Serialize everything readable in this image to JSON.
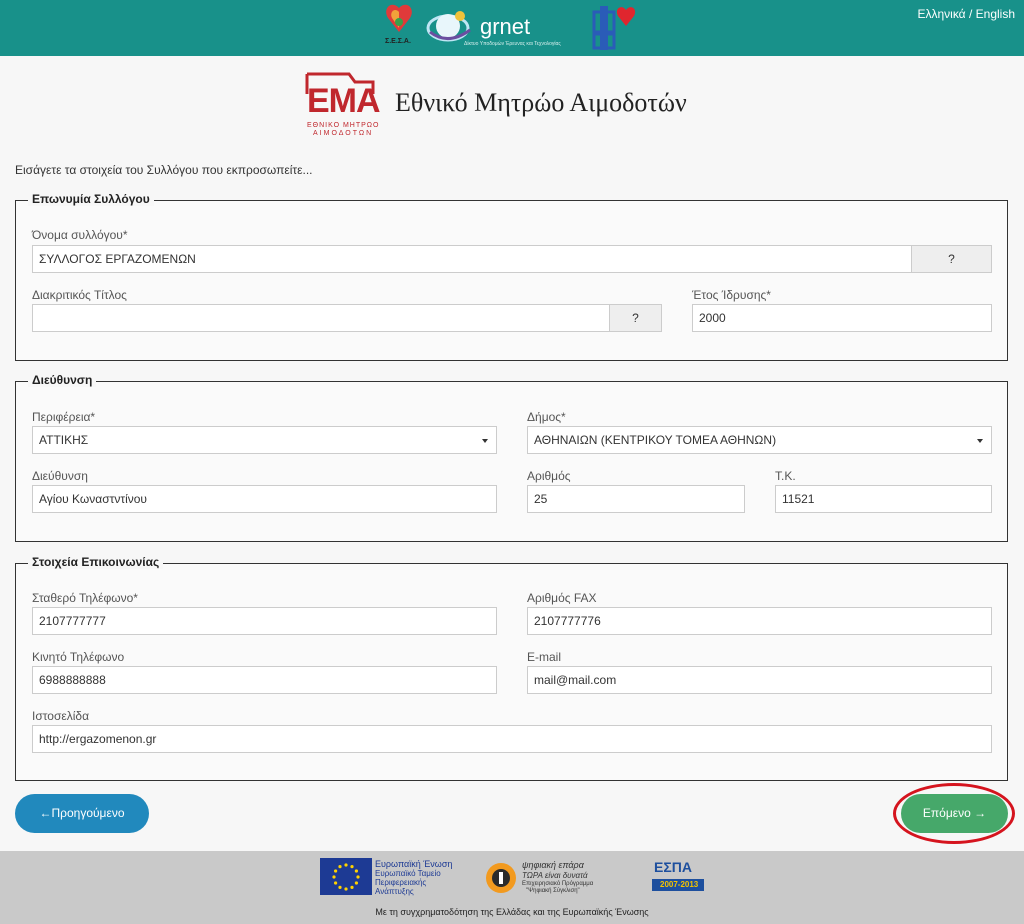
{
  "header": {
    "lang_greek": "Ελληνικά",
    "lang_sep": " / ",
    "lang_english": "English",
    "grnet_word": "grnet",
    "grnet_tagline": "Δίκτυο Υποδομών Έρευνας και Τεχνολογίας",
    "eseth_label": "Σ.Ε.Σ.Α."
  },
  "brand": {
    "title": "Εθνικό Μητρώο Αιμοδοτών",
    "logo_text": "ΕΜΑ",
    "logo_sub1": "ΕΘΝΙΚΟ ΜΗΤΡΩΟ",
    "logo_sub2": "ΑΙΜΟΔΟΤΩΝ"
  },
  "intro": "Εισάγετε τα στοιχεία του Συλλόγου που εκπροσωπείτε...",
  "section_name": {
    "legend": "Επωνυμία Συλλόγου",
    "name_label": "Όνομα συλλόγου*",
    "name_value": "ΣΥΛΛΟΓΟΣ ΕΡΓΑΖΟΜΕΝΩΝ",
    "help1": "?",
    "title_label": "Διακριτικός Τίτλος",
    "title_value": "",
    "help2": "?",
    "year_label": "Έτος Ίδρυσης*",
    "year_value": "2000"
  },
  "section_address": {
    "legend": "Διεύθυνση",
    "region_label": "Περιφέρεια*",
    "region_value": "ΑΤΤΙΚΗΣ",
    "municipality_label": "Δήμος*",
    "municipality_value": "ΑΘΗΝΑΙΩΝ (ΚΕΝΤΡΙΚΟΥ ΤΟΜΕΑ ΑΘΗΝΩΝ)",
    "street_label": "Διεύθυνση",
    "street_value": "Αγίου Κωναστντίνου",
    "number_label": "Αριθμός",
    "number_value": "25",
    "postcode_label": "Τ.Κ.",
    "postcode_value": "11521"
  },
  "section_contact": {
    "legend": "Στοιχεία Επικοινωνίας",
    "phone_label": "Σταθερό Τηλέφωνο*",
    "phone_value": "2107777777",
    "fax_label": "Αριθμός FAX",
    "fax_value": "2107777776",
    "mobile_label": "Κινητό Τηλέφωνο",
    "mobile_value": "6988888888",
    "email_label": "E-mail",
    "email_value": "mail@mail.com",
    "website_label": "Ιστοσελίδα",
    "website_value": "http://ergazomenon.gr"
  },
  "nav": {
    "prev_label": "Προηγούμενο",
    "next_label": "Επόμενο"
  },
  "footer": {
    "eu_line1": "Ευρωπαϊκή Ένωση",
    "eu_line2": "Ευρωπαϊκό Ταμείο",
    "eu_line3": "Περιφερειακής",
    "eu_line4": "Ανάπτυξης",
    "digital_line1": "ψηφιακή επάρα",
    "digital_line2": "ΤΩΡΑ είναι δυνατά",
    "digital_line3": "Επιχειρησιακό Πρόγραμμα",
    "digital_line4": "\"Ψηφιακή Σύγκλιση\"",
    "espa_word": "ΕΣΠΑ",
    "espa_years": "2007-2013",
    "cofunding": "Με τη συγχρηματοδότηση της Ελλάδας και της Ευρωπαϊκής Ένωσης"
  },
  "colors": {
    "topbar": "#18918a",
    "prev_button": "#2189bd",
    "next_button": "#46a86a",
    "highlight_ring": "#d5141e",
    "brand_red": "#c0272d"
  }
}
